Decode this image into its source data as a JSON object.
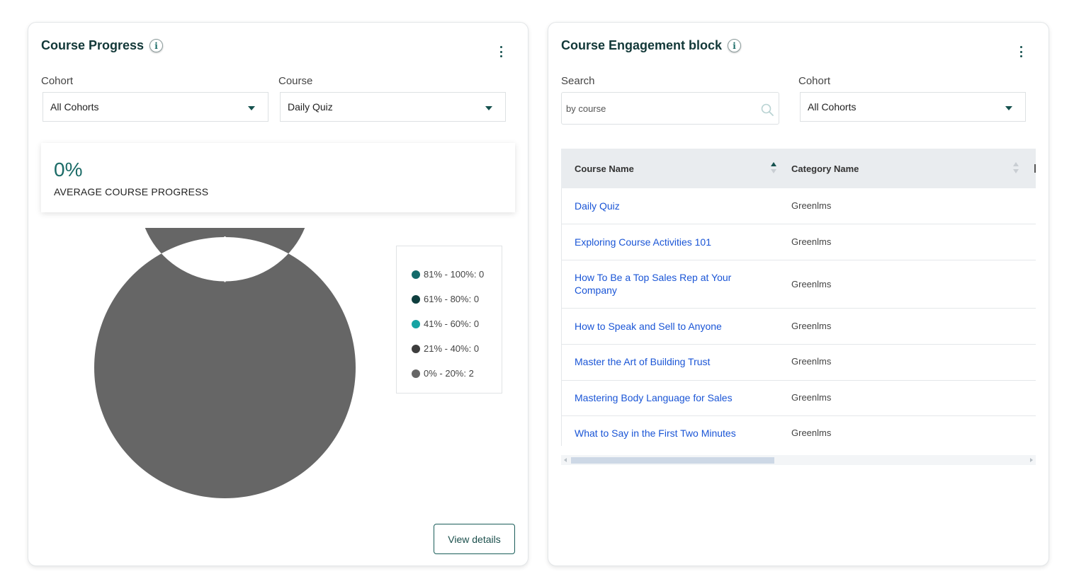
{
  "course_progress": {
    "title": "Course Progress",
    "info_icon": "info-icon",
    "menu_icon": "kebab-menu-icon",
    "cohort": {
      "label": "Cohort",
      "selected": "All Cohorts"
    },
    "course": {
      "label": "Course",
      "selected": "Daily Quiz"
    },
    "average": {
      "value": "0%",
      "label": "AVERAGE COURSE PROGRESS"
    },
    "legend": [
      {
        "label": "81% - 100%: 0",
        "color": "#136a6a"
      },
      {
        "label": "61% - 80%: 0",
        "color": "#0e3e3e"
      },
      {
        "label": "41% - 60%: 0",
        "color": "#16a3a3"
      },
      {
        "label": "21% - 40%: 0",
        "color": "#3d3d3d"
      },
      {
        "label": "0% - 20%: 2",
        "color": "#666666"
      }
    ],
    "view_details_label": "View details"
  },
  "chart_data": {
    "type": "pie",
    "donut": true,
    "categories": [
      "81% - 100%",
      "61% - 80%",
      "41% - 60%",
      "21% - 40%",
      "0% - 20%"
    ],
    "values": [
      0,
      0,
      0,
      0,
      2
    ],
    "colors": [
      "#136a6a",
      "#0e3e3e",
      "#16a3a3",
      "#3d3d3d",
      "#666666"
    ],
    "legend": "right"
  },
  "course_engagement": {
    "title": "Course Engagement block",
    "info_icon": "info-icon",
    "menu_icon": "kebab-menu-icon",
    "search": {
      "label": "Search",
      "placeholder": "by course"
    },
    "cohort": {
      "label": "Cohort",
      "selected": "All Cohorts"
    },
    "table": {
      "columns": [
        "Course Name",
        "Category Name"
      ],
      "sort": {
        "column": "Course Name",
        "direction": "ascending"
      },
      "rows": [
        {
          "course": "Daily Quiz",
          "category": "Greenlms"
        },
        {
          "course": "Exploring Course Activities 101",
          "category": "Greenlms"
        },
        {
          "course": "How To Be a Top Sales Rep at Your Company",
          "category": "Greenlms"
        },
        {
          "course": "How to Speak and Sell to Anyone",
          "category": "Greenlms"
        },
        {
          "course": "Master the Art of Building Trust",
          "category": "Greenlms"
        },
        {
          "course": "Mastering Body Language for Sales",
          "category": "Greenlms"
        },
        {
          "course": "What to Say in the First Two Minutes",
          "category": "Greenlms"
        }
      ]
    }
  }
}
